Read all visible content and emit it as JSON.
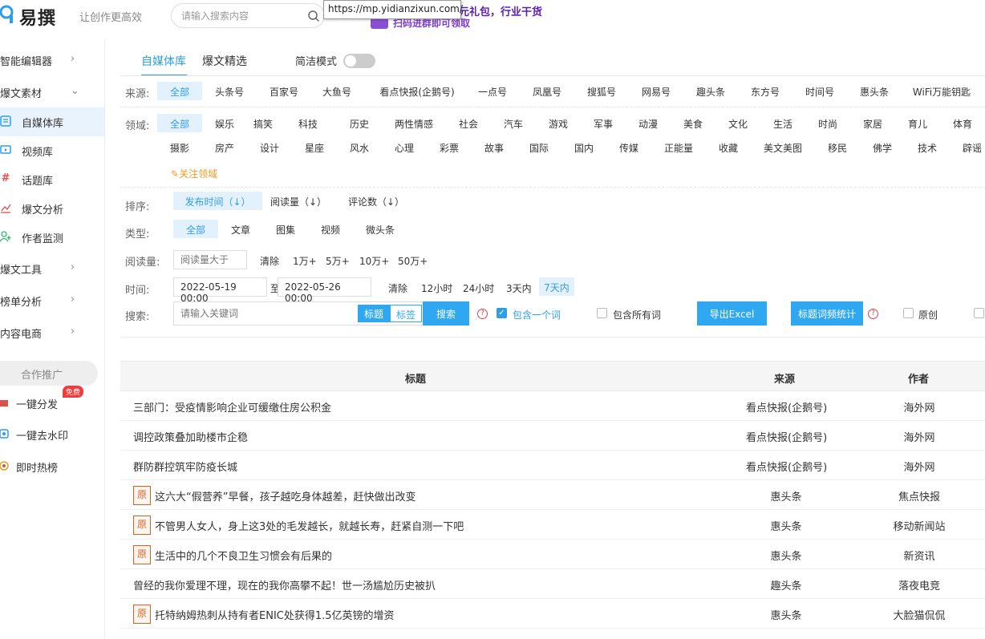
{
  "header": {
    "logo_text": "易撰",
    "slogan": "让创作更高效",
    "search_placeholder": "请输入搜索内容",
    "url_tooltip": "https://mp.yidianzixun.com/",
    "banner_line1": "元礼包，行业干货",
    "banner_line2": "扫码进群即可领取"
  },
  "sidebar": {
    "items": [
      {
        "label": "智能编辑器",
        "icon": "chevron-right-icon"
      },
      {
        "label": "爆文素材",
        "icon": "chevron-down-icon"
      },
      {
        "label": "自媒体库",
        "icon": "document-icon"
      },
      {
        "label": "视频库",
        "icon": "video-icon"
      },
      {
        "label": "话题库",
        "icon": "hash-icon"
      },
      {
        "label": "爆文分析",
        "icon": "line-chart-icon"
      },
      {
        "label": "作者监测",
        "icon": "user-add-icon"
      },
      {
        "label": "爆文工具",
        "icon": "chevron-right-icon"
      },
      {
        "label": "榜单分析",
        "icon": "chevron-right-icon"
      },
      {
        "label": "内容电商",
        "icon": "chevron-right-icon"
      }
    ],
    "coop_label": "合作推广",
    "promo": [
      {
        "label": "一键分发",
        "badge": "免费"
      },
      {
        "label": "一键去水印"
      },
      {
        "label": "即时热榜"
      }
    ]
  },
  "tabs": {
    "items": [
      "自媒体库",
      "爆文精选"
    ],
    "simple_mode_label": "简洁模式"
  },
  "filters": {
    "source_label": "来源:",
    "sources": [
      "全部",
      "头条号",
      "百家号",
      "大鱼号",
      "看点快报(企鹅号)",
      "一点号",
      "凤凰号",
      "搜狐号",
      "网易号",
      "趣头条",
      "东方号",
      "时间号",
      "惠头条",
      "WiFi万能钥匙"
    ],
    "domain_label": "领域:",
    "domains_row1": [
      "全部",
      "娱乐",
      "搞笑",
      "科技",
      "历史",
      "两性情感",
      "社会",
      "汽车",
      "游戏",
      "军事",
      "动漫",
      "美食",
      "文化",
      "生活",
      "时尚",
      "家居",
      "育儿",
      "体育"
    ],
    "domains_row2": [
      "摄影",
      "房产",
      "设计",
      "星座",
      "风水",
      "心理",
      "彩票",
      "故事",
      "国际",
      "国内",
      "传媒",
      "正能量",
      "收藏",
      "美文美图",
      "移民",
      "佛学",
      "技术",
      "辟谣"
    ],
    "follow_label": "关注领域",
    "sort_label": "排序:",
    "sorts": [
      "发布时间（↓）",
      "阅读量（↓）",
      "评论数（↓）"
    ],
    "type_label": "类型:",
    "types": [
      "全部",
      "文章",
      "图集",
      "视频",
      "微头条"
    ],
    "read_label": "阅读量:",
    "read_placeholder": "阅读量大于",
    "read_options": [
      "清除",
      "1万+",
      "5万+",
      "10万+",
      "50万+"
    ],
    "time_label": "时间:",
    "date_from": "2022-05-19 00:00",
    "date_sep": "至",
    "date_to": "2022-05-26 00:00",
    "time_options": [
      "清除",
      "12小时",
      "24小时",
      "3天内",
      "7天内"
    ],
    "search_label": "搜索:",
    "keyword_placeholder": "请输入关键词",
    "seg_title": "标题",
    "seg_tag": "标签",
    "search_btn": "搜索",
    "contains_one": "包含一个词",
    "contains_all": "包含所有词",
    "export_btn": "导出Excel",
    "wordfreq_btn": "标题词频统计",
    "original_label": "原创"
  },
  "table": {
    "headers": {
      "title": "标题",
      "source": "来源",
      "author": "作者"
    },
    "orig_mark": "原",
    "rows": [
      {
        "title": "三部门：受疫情影响企业可缓缴住房公积金",
        "source": "看点快报(企鹅号)",
        "author": "海外网",
        "original": false
      },
      {
        "title": "调控政策叠加助楼市企稳",
        "source": "看点快报(企鹅号)",
        "author": "海外网",
        "original": false
      },
      {
        "title": "群防群控筑牢防疫长城",
        "source": "看点快报(企鹅号)",
        "author": "海外网",
        "original": false
      },
      {
        "title": "这六大“假营养”早餐，孩子越吃身体越差，赶快做出改变",
        "source": "惠头条",
        "author": "焦点快报",
        "original": true
      },
      {
        "title": "不管男人女人，身上这3处的毛发越长，就越长寿，赶紧自测一下吧",
        "source": "惠头条",
        "author": "移动新闻站",
        "original": true
      },
      {
        "title": "生活中的几个不良卫生习惯会有后果的",
        "source": "惠头条",
        "author": "新资讯",
        "original": true
      },
      {
        "title": "曾经的我你爱理不理，现在的我你高攀不起！世一汤尴尬历史被扒",
        "source": "趣头条",
        "author": "落夜电竞",
        "original": false
      },
      {
        "title": "托特纳姆热刺从持有者ENIC处获得1.5亿英镑的增资",
        "source": "惠头条",
        "author": "大脸猫侃侃",
        "original": true
      }
    ]
  },
  "colors": {
    "accent": "#2f9ee8",
    "button": "#2fa8f1",
    "original": "#d2642a",
    "follow": "#f39a22"
  }
}
